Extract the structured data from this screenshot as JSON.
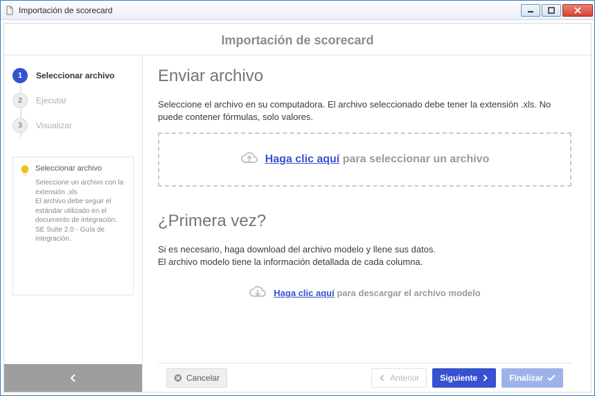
{
  "window": {
    "title": "Importación de scorecard"
  },
  "header": {
    "title": "Importación de scorecard"
  },
  "sidebar": {
    "steps": [
      {
        "num": "1",
        "label": "Seleccionar archivo"
      },
      {
        "num": "2",
        "label": "Ejecutar"
      },
      {
        "num": "3",
        "label": "Visualizar"
      }
    ],
    "tip": {
      "title": "Seleccionar archivo",
      "body": "Seleccione un archivo con la extensión .xls\nEl archivo debe seguir el estándar utilizado en el documento de integración: SE Suite 2.0 - Guía de integración."
    }
  },
  "main": {
    "send": {
      "title": "Enviar archivo",
      "desc": "Seleccione el archivo en su computadora. El archivo seleccionado debe tener la extensión .xls. No puede contener fórmulas, solo valores.",
      "link": "Haga clic aquí",
      "after": " para seleccionar un archivo"
    },
    "first": {
      "title": "¿Primera vez?",
      "desc": "Si es necesario, haga download del archivo modelo y llene sus datos.\nEl archivo modelo tiene la información detallada de cada columna.",
      "link": "Haga clic aquí",
      "after": " para descargar el archivo modelo"
    }
  },
  "footer": {
    "cancel": "Cancelar",
    "prev": "Anterior",
    "next": "Siguiente",
    "finish": "Finalizar"
  }
}
